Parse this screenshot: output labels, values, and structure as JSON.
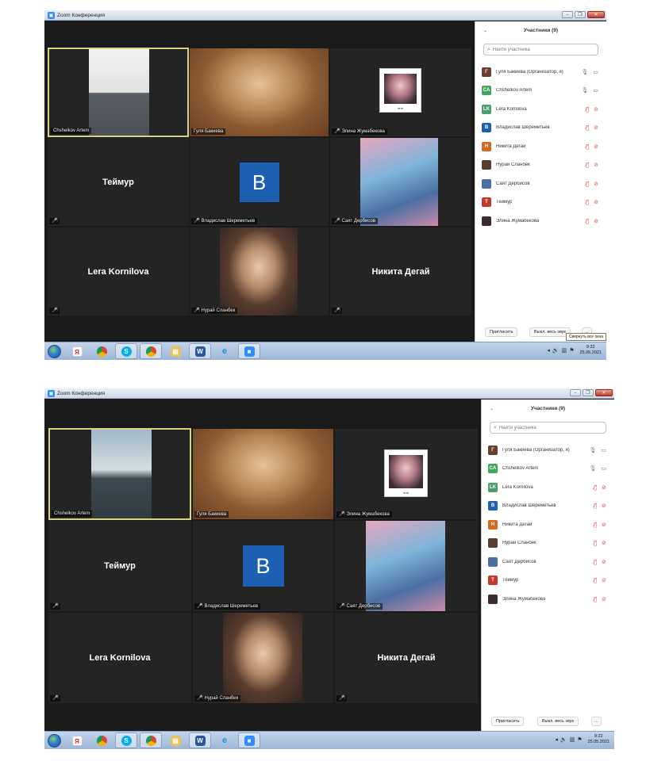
{
  "window": {
    "title": "Zoom Конференция"
  },
  "panel": {
    "header": "Участники (9)",
    "search_placeholder": "Найти участника",
    "invite_label": "Пригласить",
    "mute_all_label": "Выкл. весь звук",
    "more_label": "..."
  },
  "participants": [
    {
      "initial": "Г",
      "name": "Гуля Бакиева (Организатор, я)",
      "color": "#6b3e2e",
      "mic_muted": false,
      "cam_off": false
    },
    {
      "initial": "CA",
      "name": "Chshelkov Artem",
      "color": "#3fa65b",
      "mic_muted": false,
      "cam_off": false
    },
    {
      "initial": "LK",
      "name": "Lera Kornilova",
      "color": "#4b9d6e",
      "mic_muted": true,
      "cam_off": true
    },
    {
      "initial": "В",
      "name": "Владислав Шереметьев",
      "color": "#1d5fb3",
      "mic_muted": true,
      "cam_off": true
    },
    {
      "initial": "Н",
      "name": "Никита Дегай",
      "color": "#d2691e",
      "mic_muted": true,
      "cam_off": true
    },
    {
      "initial": "",
      "name": "Нурай Сланбек",
      "color": "#5a3d2e",
      "mic_muted": true,
      "cam_off": true
    },
    {
      "initial": "",
      "name": "Саят Дербисов",
      "color": "#4a6fa3",
      "mic_muted": true,
      "cam_off": true
    },
    {
      "initial": "Т",
      "name": "Теймур",
      "color": "#c0392b",
      "mic_muted": true,
      "cam_off": true
    },
    {
      "initial": "",
      "name": "Элина Жумабекова",
      "color": "#3a2a33",
      "mic_muted": true,
      "cam_off": true
    }
  ],
  "tiles": {
    "artem": "Chshelkov Artem",
    "gulya": "Гуля Бакиева",
    "elina": "Элина Жумабекова",
    "teymur": "Теймур",
    "vladislav": "Владислав Шереметьев",
    "vladislav_initial": "B",
    "sayat": "Саят Дербисов",
    "lera": "Lera Kornilova",
    "nuray": "Нурай Сланбек",
    "nikita": "Никита Дегай"
  },
  "tooltip": "Свернуть все окна",
  "clock": {
    "time": "9:22",
    "date": "25.05.2021"
  },
  "colors": {
    "active_speaker_border": "#d7d482",
    "mute_red": "#e5484d",
    "zoom_blue": "#2d8cff"
  },
  "taskbar_icons": [
    "windows-start-icon",
    "yandex-browser-icon",
    "chrome-icon",
    "skype-icon",
    "chrome-icon",
    "file-explorer-icon",
    "word-icon",
    "internet-explorer-icon",
    "zoom-icon"
  ]
}
